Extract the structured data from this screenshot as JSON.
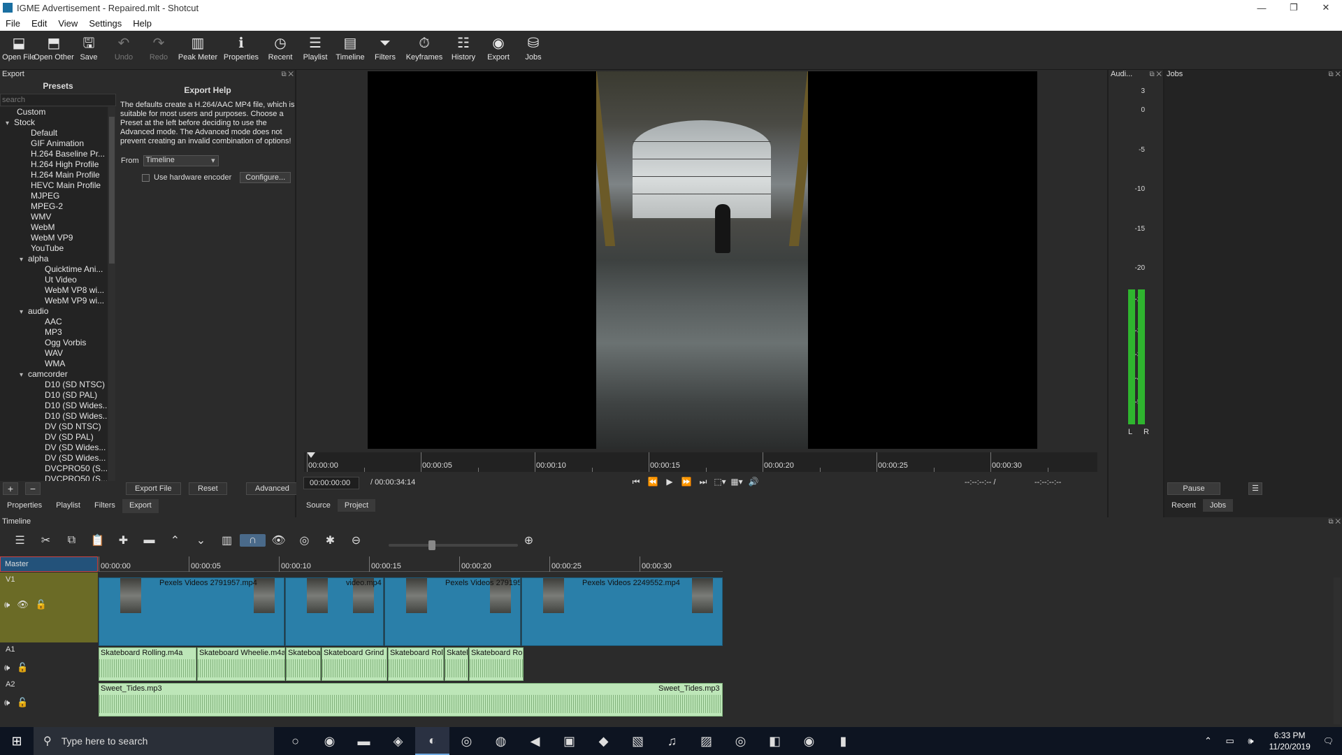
{
  "window": {
    "title": "IGME Advertisement - Repaired.mlt - Shotcut",
    "controls": [
      "—",
      "❐",
      "✕"
    ]
  },
  "menu": [
    "File",
    "Edit",
    "View",
    "Settings",
    "Help"
  ],
  "toolbar": [
    {
      "label": "Open File",
      "icon": "open-file-icon",
      "glyph": "⬓",
      "enabled": true
    },
    {
      "label": "Open Other",
      "icon": "open-other-icon",
      "glyph": "⬒",
      "enabled": true
    },
    {
      "label": "Save",
      "icon": "save-icon",
      "glyph": "🖫",
      "enabled": true
    },
    {
      "label": "Undo",
      "icon": "undo-icon",
      "glyph": "↶",
      "enabled": false
    },
    {
      "label": "Redo",
      "icon": "redo-icon",
      "glyph": "↷",
      "enabled": false
    },
    {
      "label": "Peak Meter",
      "icon": "peak-meter-icon",
      "glyph": "▥",
      "enabled": true
    },
    {
      "label": "Properties",
      "icon": "properties-icon",
      "glyph": "ℹ",
      "enabled": true
    },
    {
      "label": "Recent",
      "icon": "recent-icon",
      "glyph": "◷",
      "enabled": true
    },
    {
      "label": "Playlist",
      "icon": "playlist-icon",
      "glyph": "☰",
      "enabled": true
    },
    {
      "label": "Timeline",
      "icon": "timeline-icon",
      "glyph": "▤",
      "enabled": true
    },
    {
      "label": "Filters",
      "icon": "filters-icon",
      "glyph": "⏷",
      "enabled": true
    },
    {
      "label": "Keyframes",
      "icon": "keyframes-icon",
      "glyph": "⏱",
      "enabled": true
    },
    {
      "label": "History",
      "icon": "history-icon",
      "glyph": "☷",
      "enabled": true
    },
    {
      "label": "Export",
      "icon": "export-icon",
      "glyph": "◉",
      "enabled": true
    },
    {
      "label": "Jobs",
      "icon": "jobs-icon",
      "glyph": "⛁",
      "enabled": true
    }
  ],
  "export": {
    "panel_title": "Export",
    "presets_title": "Presets",
    "search_placeholder": "search",
    "presets": [
      {
        "label": "Custom",
        "kind": "item",
        "level": 0
      },
      {
        "label": "Stock",
        "kind": "group",
        "level": 0
      },
      {
        "label": "Default",
        "kind": "item",
        "level": 1
      },
      {
        "label": "GIF Animation",
        "kind": "item",
        "level": 1
      },
      {
        "label": "H.264 Baseline Pr...",
        "kind": "item",
        "level": 1
      },
      {
        "label": "H.264 High Profile",
        "kind": "item",
        "level": 1
      },
      {
        "label": "H.264 Main Profile",
        "kind": "item",
        "level": 1
      },
      {
        "label": "HEVC Main Profile",
        "kind": "item",
        "level": 1
      },
      {
        "label": "MJPEG",
        "kind": "item",
        "level": 1
      },
      {
        "label": "MPEG-2",
        "kind": "item",
        "level": 1
      },
      {
        "label": "WMV",
        "kind": "item",
        "level": 1
      },
      {
        "label": "WebM",
        "kind": "item",
        "level": 1
      },
      {
        "label": "WebM VP9",
        "kind": "item",
        "level": 1
      },
      {
        "label": "YouTube",
        "kind": "item",
        "level": 1
      },
      {
        "label": "alpha",
        "kind": "group",
        "level": 1
      },
      {
        "label": "Quicktime Ani...",
        "kind": "item",
        "level": 2
      },
      {
        "label": "Ut Video",
        "kind": "item",
        "level": 2
      },
      {
        "label": "WebM VP8 wi...",
        "kind": "item",
        "level": 2
      },
      {
        "label": "WebM VP9 wi...",
        "kind": "item",
        "level": 2
      },
      {
        "label": "audio",
        "kind": "group",
        "level": 1
      },
      {
        "label": "AAC",
        "kind": "item",
        "level": 2
      },
      {
        "label": "MP3",
        "kind": "item",
        "level": 2
      },
      {
        "label": "Ogg Vorbis",
        "kind": "item",
        "level": 2
      },
      {
        "label": "WAV",
        "kind": "item",
        "level": 2
      },
      {
        "label": "WMA",
        "kind": "item",
        "level": 2
      },
      {
        "label": "camcorder",
        "kind": "group",
        "level": 1
      },
      {
        "label": "D10 (SD NTSC)",
        "kind": "item",
        "level": 2
      },
      {
        "label": "D10 (SD PAL)",
        "kind": "item",
        "level": 2
      },
      {
        "label": "D10 (SD Wides...",
        "kind": "item",
        "level": 2
      },
      {
        "label": "D10 (SD Wides...",
        "kind": "item",
        "level": 2
      },
      {
        "label": "DV (SD NTSC)",
        "kind": "item",
        "level": 2
      },
      {
        "label": "DV (SD PAL)",
        "kind": "item",
        "level": 2
      },
      {
        "label": "DV (SD Wides...",
        "kind": "item",
        "level": 2
      },
      {
        "label": "DV (SD Wides...",
        "kind": "item",
        "level": 2
      },
      {
        "label": "DVCPRO50 (S...",
        "kind": "item",
        "level": 2
      },
      {
        "label": "DVCPRO50 (S...",
        "kind": "item",
        "level": 2
      }
    ],
    "help_title": "Export Help",
    "help_text": "The defaults create a H.264/AAC MP4 file, which is suitable for most users and purposes. Choose a Preset at the left before deciding to use the Advanced mode. The Advanced mode does not prevent creating an invalid combination of options!",
    "from_label": "From",
    "from_value": "Timeline",
    "hw_encoder_label": "Use hardware encoder",
    "configure_label": "Configure...",
    "add_label": "+",
    "remove_label": "−",
    "export_file_label": "Export File",
    "reset_label": "Reset",
    "advanced_label": "Advanced"
  },
  "left_tabs": [
    "Properties",
    "Playlist",
    "Filters",
    "Export"
  ],
  "player": {
    "ruler_labels": [
      "00:00:00",
      "00:00:05",
      "00:00:10",
      "00:00:15",
      "00:00:20",
      "00:00:25",
      "00:00:30"
    ],
    "current_time": "00:00:00:00",
    "total_time": "/ 00:00:34:14",
    "transport": [
      "⏮",
      "⏪",
      "▶",
      "⏩",
      "⏭",
      "⬚▾",
      "▦▾",
      "🔊"
    ],
    "in_point": "--:--:--:-- /",
    "out_point": "--:--:--:--",
    "tabs": [
      "Source",
      "Project"
    ]
  },
  "audio": {
    "title": "Audi...",
    "scale": [
      "3",
      "0",
      "-5",
      "-10",
      "-15",
      "-20",
      "-25",
      "-30",
      "-35",
      "-40",
      "-50"
    ],
    "left_label": "L",
    "right_label": "R",
    "level_color": "#2fb52f"
  },
  "jobs": {
    "title": "Jobs",
    "pause_label": "Pause",
    "menu_label": "☰",
    "tabs": [
      "Recent",
      "Jobs"
    ]
  },
  "timeline": {
    "title": "Timeline",
    "tools": [
      "☰",
      "✂",
      "⧉",
      "📋",
      "✚",
      "▬",
      "⌃",
      "⌄",
      "▥",
      "∩",
      "👁",
      "◎",
      "✱",
      "⊖",
      "⊕"
    ],
    "ruler_labels": [
      "00:00:00",
      "00:00:05",
      "00:00:10",
      "00:00:15",
      "00:00:20",
      "00:00:25",
      "00:00:30"
    ],
    "tracks": {
      "master": "Master",
      "v1": "V1",
      "a1": "A1",
      "a2": "A2"
    },
    "video_clips": [
      {
        "name": "Pexels Videos 2791957.mp4"
      },
      {
        "name": "video.mp4"
      },
      {
        "name": "Pexels Videos 279195"
      },
      {
        "name": "Pexels Videos 2249552.mp4"
      }
    ],
    "audio_clips": [
      {
        "name": "Skateboard Rolling.m4a"
      },
      {
        "name": "Skateboard Wheelie.m4a"
      },
      {
        "name": "Skateboar"
      },
      {
        "name": "Skateboard Grind"
      },
      {
        "name": "Skateboard Rolli"
      },
      {
        "name": "Skatel"
      },
      {
        "name": "Skateboard Rolli"
      }
    ],
    "music_clip": {
      "name": "Sweet_Tides.mp3",
      "name_end": "Sweet_Tides.mp3"
    }
  },
  "taskbar": {
    "search_placeholder": "Type here to search",
    "apps": [
      "○",
      "◉",
      "▬",
      "◈",
      "◐",
      "◎",
      "◍",
      "◀",
      "▣",
      "◆",
      "▧",
      "♫",
      "▨",
      "◎",
      "◧",
      "◉",
      "▮"
    ],
    "time": "6:33 PM",
    "date": "11/20/2019",
    "tray": "⌃ ▭ 🕪"
  }
}
